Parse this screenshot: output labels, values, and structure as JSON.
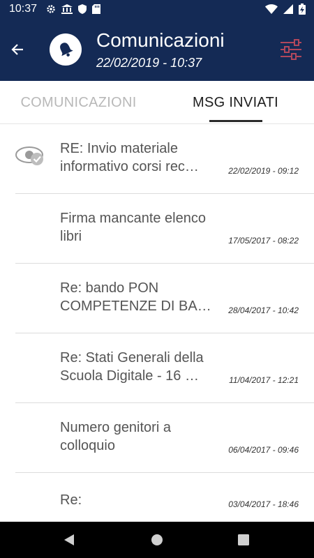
{
  "status_bar": {
    "time": "10:37"
  },
  "header": {
    "title": "Comunicazioni",
    "subtitle": "22/02/2019 - 10:37"
  },
  "tabs": [
    {
      "label": "COMUNICAZIONI",
      "active": false
    },
    {
      "label": "MSG INVIATI",
      "active": true
    }
  ],
  "messages": [
    {
      "title": "RE: Invio materiale informativo corsi rec…",
      "date": "22/02/2019 - 09:12",
      "read_icon": true
    },
    {
      "title": "Firma mancante elenco libri",
      "date": "17/05/2017 - 08:22",
      "read_icon": false
    },
    {
      "title": "Re: bando PON COMPETENZE DI BA…",
      "date": "28/04/2017 - 10:42",
      "read_icon": false
    },
    {
      "title": "Re: Stati Generali della Scuola Digitale - 16 …",
      "date": "11/04/2017 - 12:21",
      "read_icon": false
    },
    {
      "title": "Numero genitori a colloquio",
      "date": "06/04/2017 - 09:46",
      "read_icon": false
    },
    {
      "title": "Re:",
      "date": "03/04/2017 - 18:46",
      "read_icon": false
    }
  ],
  "colors": {
    "header_bg": "#142a55",
    "accent_filter": "#b0475c"
  }
}
